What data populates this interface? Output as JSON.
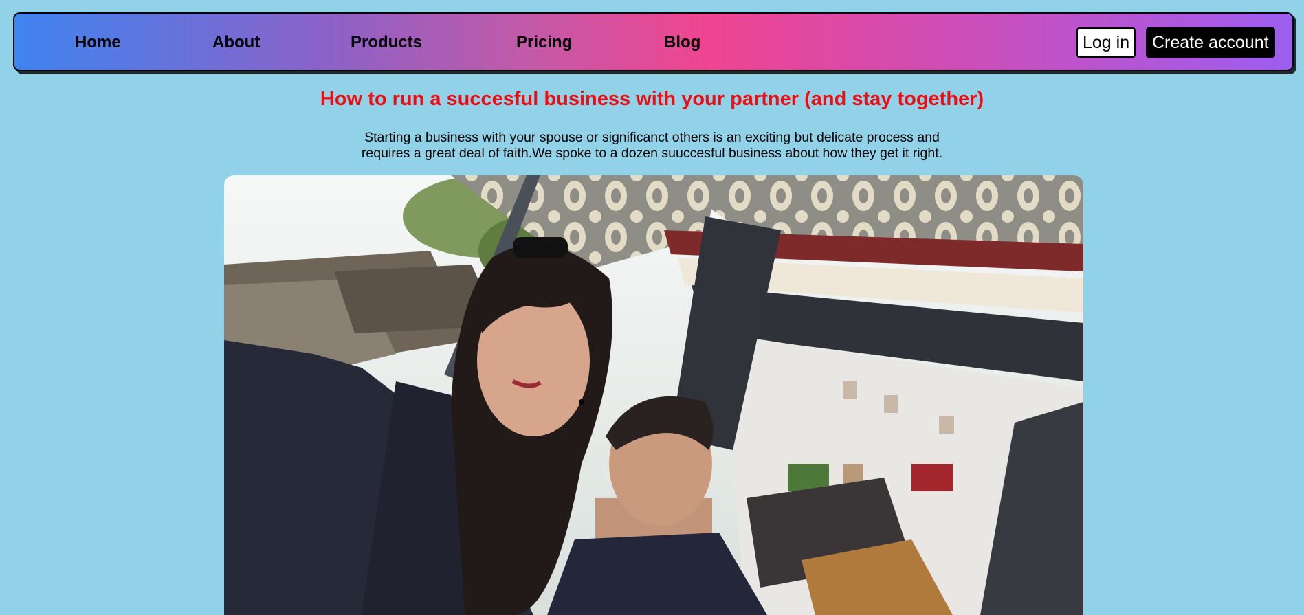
{
  "nav": {
    "links": [
      "Home",
      "About",
      "Products",
      "Pricing",
      "Blog"
    ],
    "login_label": "Log in",
    "signup_label": "Create account"
  },
  "article": {
    "title": "How to run a succesful business with your partner (and stay together)",
    "intro_line1": "Starting a business with your spouse or significanct others is an exciting but delicate process and",
    "intro_line2": "requires a great deal of faith.We spoke to a dozen suuccesful business about how they get it right.",
    "hero_alt": "Selfie of a smiling couple at an outdoor restaurant"
  },
  "colors": {
    "page_background": "#92d2e8",
    "title_red": "#ee0b12",
    "nav_gradient": [
      "#3f84f0",
      "#ef4590",
      "#9c5ef0"
    ]
  }
}
